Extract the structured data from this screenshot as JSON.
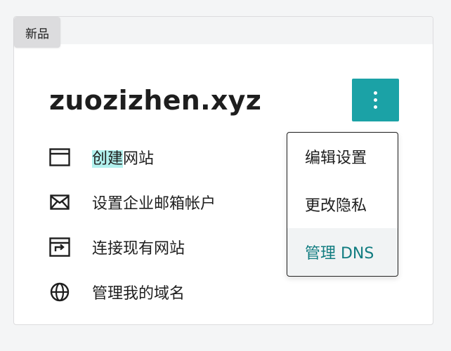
{
  "card": {
    "badge": "新品",
    "domain": "zuozizhen.xyz"
  },
  "actions": [
    {
      "icon": "browser-window-icon",
      "label_highlight": "创建",
      "label_rest": "网站"
    },
    {
      "icon": "envelope-icon",
      "label": "设置企业邮箱帐户"
    },
    {
      "icon": "browser-redirect-icon",
      "label": "连接现有网站"
    },
    {
      "icon": "globe-icon",
      "label": "管理我的域名"
    }
  ],
  "menu": {
    "button_icon": "more-vertical-icon",
    "items": [
      {
        "label": "编辑设置"
      },
      {
        "label": "更改隐私"
      },
      {
        "label": "管理 DNS",
        "active": true
      }
    ]
  },
  "colors": {
    "accent": "#1ba2a6",
    "active_text": "#117c80",
    "highlight": "#b2f1ee",
    "badge_bg": "#dcdcde"
  }
}
